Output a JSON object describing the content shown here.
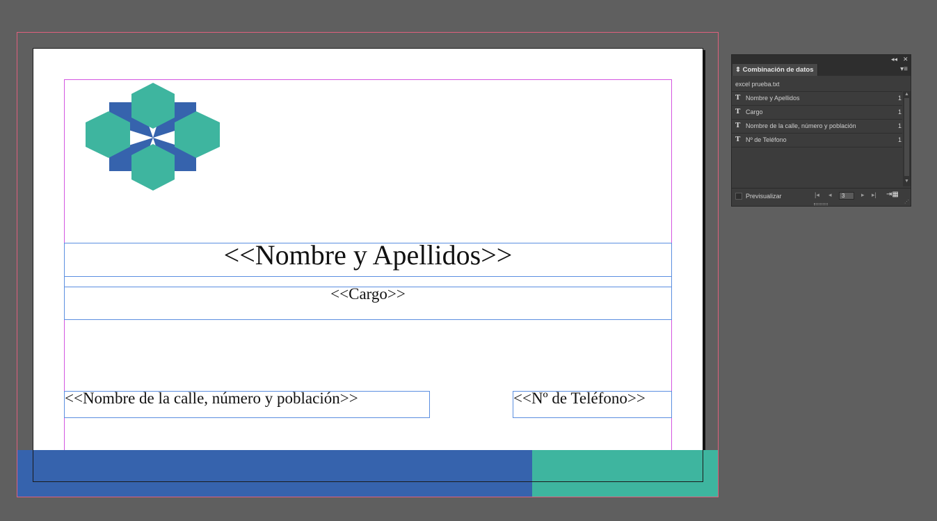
{
  "document": {
    "placeholders": {
      "name": "<<Nombre y Apellidos>>",
      "cargo": "<<Cargo>>",
      "address": "<<Nombre de la calle, número y población>>",
      "phone": "<<Nº de Teléfono>>"
    },
    "colors": {
      "blue": "#3663ad",
      "teal": "#3eb59f",
      "bleed": "#e0607e",
      "margin": "#d354e0",
      "frame": "#5a8ee0"
    }
  },
  "panel": {
    "title": "Combinación de datos",
    "source_file": "excel prueba.txt",
    "fields": [
      {
        "type_icon": "T",
        "label": "Nombre y Apellidos",
        "count": "1"
      },
      {
        "type_icon": "T",
        "label": "Cargo",
        "count": "1"
      },
      {
        "type_icon": "T",
        "label": "Nombre de la calle, número y población",
        "count": "1"
      },
      {
        "type_icon": "T",
        "label": "Nº de Teléfono",
        "count": "1"
      }
    ],
    "preview_label": "Previsualizar",
    "record_number": "3"
  }
}
